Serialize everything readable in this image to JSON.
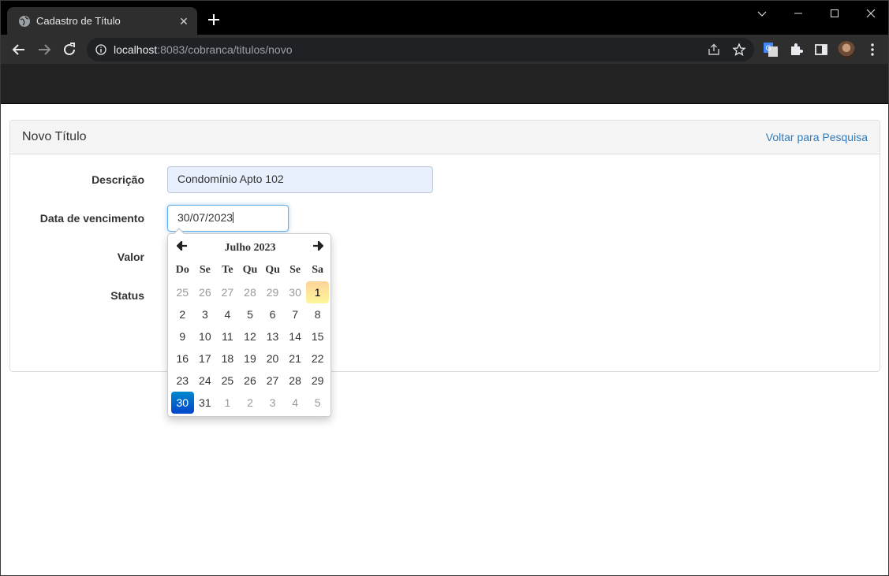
{
  "browser": {
    "tab_title": "Cadastro de Título",
    "tab_close": "✕",
    "url_host": "localhost",
    "url_rest": ":8083/cobranca/titulos/novo"
  },
  "panel": {
    "title": "Novo Título",
    "back_link": "Voltar para Pesquisa"
  },
  "form": {
    "descricao_label": "Descrição",
    "descricao_value": "Condomínio Apto 102",
    "vencimento_label": "Data de vencimento",
    "vencimento_value": "30/07/2023",
    "valor_label": "Valor",
    "status_label": "Status"
  },
  "datepicker": {
    "prev": "🡄",
    "next": "🡆",
    "month_year": "Julho 2023",
    "weekdays": [
      "Do",
      "Se",
      "Te",
      "Qu",
      "Qu",
      "Se",
      "Sa"
    ],
    "weeks": [
      [
        "25",
        "26",
        "27",
        "28",
        "29",
        "30",
        "1"
      ],
      [
        "2",
        "3",
        "4",
        "5",
        "6",
        "7",
        "8"
      ],
      [
        "9",
        "10",
        "11",
        "12",
        "13",
        "14",
        "15"
      ],
      [
        "16",
        "17",
        "18",
        "19",
        "20",
        "21",
        "22"
      ],
      [
        "23",
        "24",
        "25",
        "26",
        "27",
        "28",
        "29"
      ],
      [
        "30",
        "31",
        "1",
        "2",
        "3",
        "4",
        "5"
      ]
    ],
    "old_cells": [
      [
        0,
        0
      ],
      [
        0,
        1
      ],
      [
        0,
        2
      ],
      [
        0,
        3
      ],
      [
        0,
        4
      ],
      [
        0,
        5
      ],
      [
        5,
        2
      ],
      [
        5,
        3
      ],
      [
        5,
        4
      ],
      [
        5,
        5
      ],
      [
        5,
        6
      ]
    ],
    "today_cell": [
      0,
      6
    ],
    "active_cell": [
      5,
      0
    ]
  }
}
